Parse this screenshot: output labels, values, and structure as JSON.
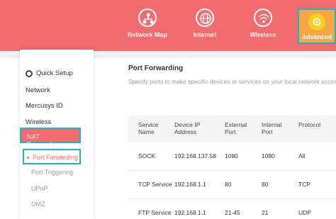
{
  "header": {
    "nav": [
      {
        "label": "Network Map",
        "icon": "network-map-icon"
      },
      {
        "label": "Internet",
        "icon": "globe-icon"
      },
      {
        "label": "Wireless",
        "icon": "wifi-icon"
      },
      {
        "label": "Advanced",
        "icon": "gear-icon"
      }
    ],
    "accent": "#f26b6f",
    "highlight": "#18b6c8"
  },
  "sidebar": {
    "quick_setup": "Quick Setup",
    "items": [
      "Network",
      "Mercusys ID",
      "Wireless",
      "NAT Forwarding"
    ],
    "subitems": [
      "Port Forwarding",
      "Port Triggering",
      "UPnP",
      "DMZ"
    ]
  },
  "main": {
    "title": "Port Forwarding",
    "description": "Specify ports to make specific devices or services on your local network access",
    "columns": [
      "Service\nName",
      "Device IP\nAddress",
      "External\nPort",
      "Internal\nPort",
      "Protocol"
    ],
    "rows": [
      [
        "SOCK",
        "192.168.137.58",
        "1080",
        "1080",
        "All"
      ],
      [
        "TCP Service",
        "192.168.1.1",
        "80",
        "80",
        "TCP"
      ],
      [
        "FTP Service",
        "192.168.1.1",
        "21-45",
        "21",
        "UDP"
      ]
    ]
  }
}
